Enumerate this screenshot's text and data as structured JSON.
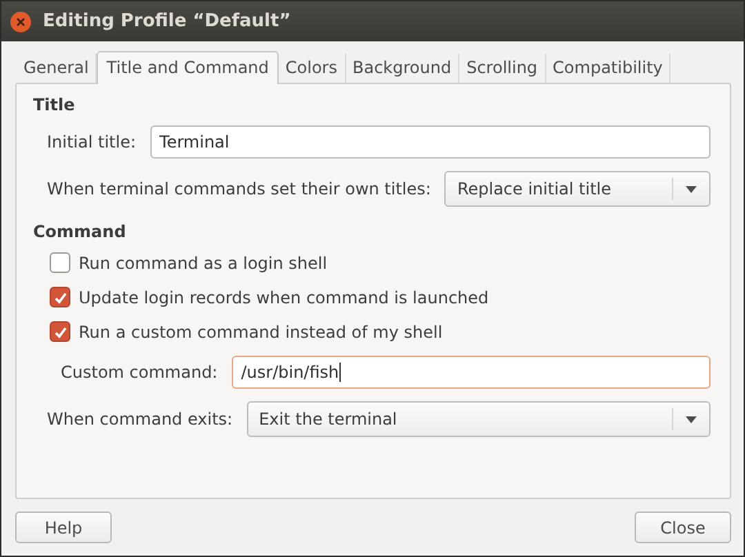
{
  "window": {
    "title": "Editing Profile “Default”"
  },
  "tabs": [
    {
      "label": "General",
      "selected": false
    },
    {
      "label": "Title and Command",
      "selected": true
    },
    {
      "label": "Colors",
      "selected": false
    },
    {
      "label": "Background",
      "selected": false
    },
    {
      "label": "Scrolling",
      "selected": false
    },
    {
      "label": "Compatibility",
      "selected": false
    }
  ],
  "sections": [
    {
      "heading": "Title",
      "items": [
        {
          "kind": "field",
          "label": "Initial title:",
          "value": "Terminal",
          "focused": false
        },
        {
          "kind": "select",
          "label": "When terminal commands set their own titles:",
          "value": "Replace initial title"
        }
      ]
    },
    {
      "heading": "Command",
      "items": [
        {
          "kind": "checkbox",
          "label": "Run command as a login shell",
          "checked": false
        },
        {
          "kind": "checkbox",
          "label": "Update login records when command is launched",
          "checked": true
        },
        {
          "kind": "checkbox",
          "label": "Run a custom command instead of my shell",
          "checked": true,
          "children": [
            {
              "kind": "field",
              "label": "Custom command:",
              "value": "/usr/bin/fish",
              "focused": true
            }
          ]
        },
        {
          "kind": "select",
          "label": "When command exits:",
          "value": "Exit the terminal"
        }
      ]
    }
  ],
  "buttons": [
    {
      "label": "Help"
    },
    {
      "label": "Close"
    }
  ]
}
